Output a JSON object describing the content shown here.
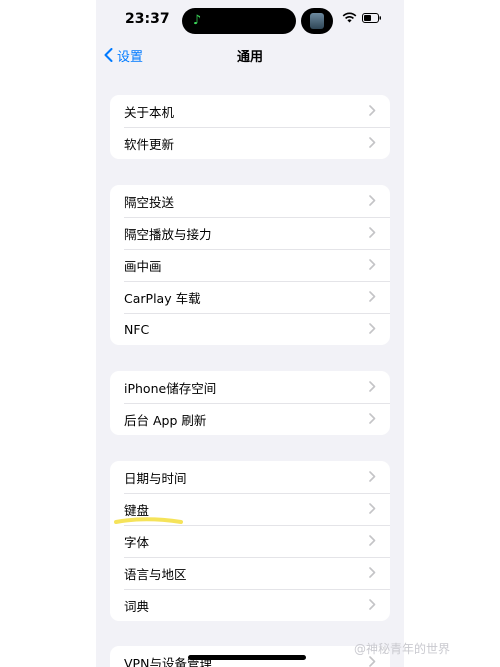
{
  "status_bar": {
    "time": "23:37",
    "island_app_icon": "music-app-icon",
    "wifi_icon": "wifi-icon",
    "battery_icon": "battery-icon"
  },
  "nav": {
    "back_label": "设置",
    "title": "通用"
  },
  "groups": [
    {
      "items": [
        "关于本机",
        "软件更新"
      ]
    },
    {
      "items": [
        "隔空投送",
        "隔空播放与接力",
        "画中画",
        "CarPlay 车载",
        "NFC"
      ]
    },
    {
      "items": [
        "iPhone储存空间",
        "后台 App 刷新"
      ]
    },
    {
      "items": [
        "日期与时间",
        "键盘",
        "字体",
        "语言与地区",
        "词典"
      ]
    },
    {
      "items": [
        "VPN与设备管理"
      ]
    }
  ],
  "watermark": "@神秘青年的世界",
  "colors": {
    "accent": "#007aff",
    "background": "#f2f2f7",
    "highlight": "#f5e35a"
  }
}
